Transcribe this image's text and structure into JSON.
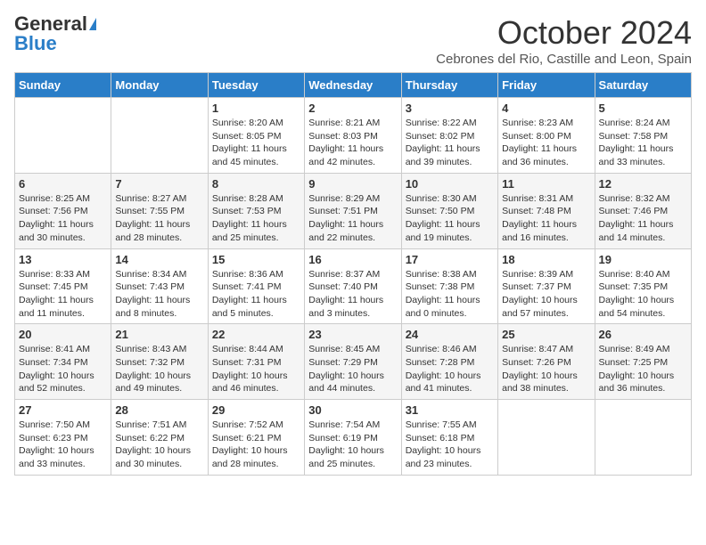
{
  "header": {
    "logo_general": "General",
    "logo_blue": "Blue",
    "month_title": "October 2024",
    "location": "Cebrones del Rio, Castille and Leon, Spain"
  },
  "days_of_week": [
    "Sunday",
    "Monday",
    "Tuesday",
    "Wednesday",
    "Thursday",
    "Friday",
    "Saturday"
  ],
  "weeks": [
    [
      {
        "day": "",
        "info": ""
      },
      {
        "day": "",
        "info": ""
      },
      {
        "day": "1",
        "info": "Sunrise: 8:20 AM\nSunset: 8:05 PM\nDaylight: 11 hours and 45 minutes."
      },
      {
        "day": "2",
        "info": "Sunrise: 8:21 AM\nSunset: 8:03 PM\nDaylight: 11 hours and 42 minutes."
      },
      {
        "day": "3",
        "info": "Sunrise: 8:22 AM\nSunset: 8:02 PM\nDaylight: 11 hours and 39 minutes."
      },
      {
        "day": "4",
        "info": "Sunrise: 8:23 AM\nSunset: 8:00 PM\nDaylight: 11 hours and 36 minutes."
      },
      {
        "day": "5",
        "info": "Sunrise: 8:24 AM\nSunset: 7:58 PM\nDaylight: 11 hours and 33 minutes."
      }
    ],
    [
      {
        "day": "6",
        "info": "Sunrise: 8:25 AM\nSunset: 7:56 PM\nDaylight: 11 hours and 30 minutes."
      },
      {
        "day": "7",
        "info": "Sunrise: 8:27 AM\nSunset: 7:55 PM\nDaylight: 11 hours and 28 minutes."
      },
      {
        "day": "8",
        "info": "Sunrise: 8:28 AM\nSunset: 7:53 PM\nDaylight: 11 hours and 25 minutes."
      },
      {
        "day": "9",
        "info": "Sunrise: 8:29 AM\nSunset: 7:51 PM\nDaylight: 11 hours and 22 minutes."
      },
      {
        "day": "10",
        "info": "Sunrise: 8:30 AM\nSunset: 7:50 PM\nDaylight: 11 hours and 19 minutes."
      },
      {
        "day": "11",
        "info": "Sunrise: 8:31 AM\nSunset: 7:48 PM\nDaylight: 11 hours and 16 minutes."
      },
      {
        "day": "12",
        "info": "Sunrise: 8:32 AM\nSunset: 7:46 PM\nDaylight: 11 hours and 14 minutes."
      }
    ],
    [
      {
        "day": "13",
        "info": "Sunrise: 8:33 AM\nSunset: 7:45 PM\nDaylight: 11 hours and 11 minutes."
      },
      {
        "day": "14",
        "info": "Sunrise: 8:34 AM\nSunset: 7:43 PM\nDaylight: 11 hours and 8 minutes."
      },
      {
        "day": "15",
        "info": "Sunrise: 8:36 AM\nSunset: 7:41 PM\nDaylight: 11 hours and 5 minutes."
      },
      {
        "day": "16",
        "info": "Sunrise: 8:37 AM\nSunset: 7:40 PM\nDaylight: 11 hours and 3 minutes."
      },
      {
        "day": "17",
        "info": "Sunrise: 8:38 AM\nSunset: 7:38 PM\nDaylight: 11 hours and 0 minutes."
      },
      {
        "day": "18",
        "info": "Sunrise: 8:39 AM\nSunset: 7:37 PM\nDaylight: 10 hours and 57 minutes."
      },
      {
        "day": "19",
        "info": "Sunrise: 8:40 AM\nSunset: 7:35 PM\nDaylight: 10 hours and 54 minutes."
      }
    ],
    [
      {
        "day": "20",
        "info": "Sunrise: 8:41 AM\nSunset: 7:34 PM\nDaylight: 10 hours and 52 minutes."
      },
      {
        "day": "21",
        "info": "Sunrise: 8:43 AM\nSunset: 7:32 PM\nDaylight: 10 hours and 49 minutes."
      },
      {
        "day": "22",
        "info": "Sunrise: 8:44 AM\nSunset: 7:31 PM\nDaylight: 10 hours and 46 minutes."
      },
      {
        "day": "23",
        "info": "Sunrise: 8:45 AM\nSunset: 7:29 PM\nDaylight: 10 hours and 44 minutes."
      },
      {
        "day": "24",
        "info": "Sunrise: 8:46 AM\nSunset: 7:28 PM\nDaylight: 10 hours and 41 minutes."
      },
      {
        "day": "25",
        "info": "Sunrise: 8:47 AM\nSunset: 7:26 PM\nDaylight: 10 hours and 38 minutes."
      },
      {
        "day": "26",
        "info": "Sunrise: 8:49 AM\nSunset: 7:25 PM\nDaylight: 10 hours and 36 minutes."
      }
    ],
    [
      {
        "day": "27",
        "info": "Sunrise: 7:50 AM\nSunset: 6:23 PM\nDaylight: 10 hours and 33 minutes."
      },
      {
        "day": "28",
        "info": "Sunrise: 7:51 AM\nSunset: 6:22 PM\nDaylight: 10 hours and 30 minutes."
      },
      {
        "day": "29",
        "info": "Sunrise: 7:52 AM\nSunset: 6:21 PM\nDaylight: 10 hours and 28 minutes."
      },
      {
        "day": "30",
        "info": "Sunrise: 7:54 AM\nSunset: 6:19 PM\nDaylight: 10 hours and 25 minutes."
      },
      {
        "day": "31",
        "info": "Sunrise: 7:55 AM\nSunset: 6:18 PM\nDaylight: 10 hours and 23 minutes."
      },
      {
        "day": "",
        "info": ""
      },
      {
        "day": "",
        "info": ""
      }
    ]
  ]
}
